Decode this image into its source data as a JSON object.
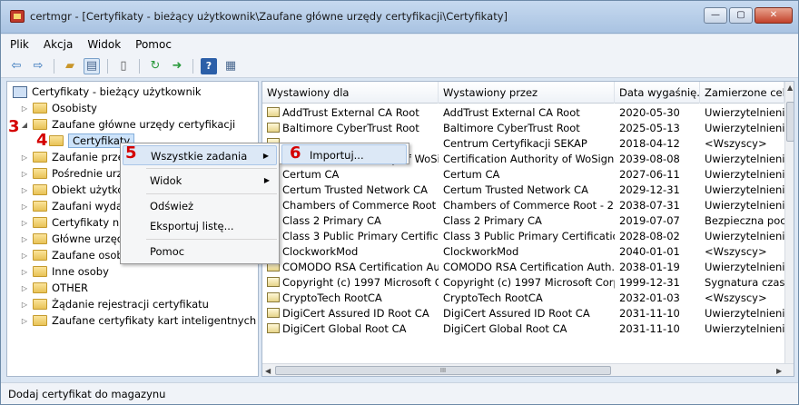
{
  "window": {
    "title": "certmgr - [Certyfikaty - bieżący użytkownik\\Zaufane główne urzędy certyfikacji\\Certyfikaty]",
    "minimize": "—",
    "maximize": "▢",
    "close": "✕"
  },
  "menu": [
    "Plik",
    "Akcja",
    "Widok",
    "Pomoc"
  ],
  "tree": {
    "root": "Certyfikaty - bieżący użytkownik",
    "items": [
      "Osobisty",
      "Zaufane główne urzędy certyfikacji",
      "Certyfikaty",
      "Zaufanie przed",
      "Pośrednie urze",
      "Obiekt użytkow",
      "Zaufani wydaw",
      "Certyfikaty nie",
      "Główne urzędy",
      "Zaufane osoby",
      "Inne osoby",
      "OTHER",
      "Żądanie rejestracji certyfikatu",
      "Zaufane certyfikaty kart inteligentnych"
    ]
  },
  "table": {
    "columns": [
      "Wystawiony dla",
      "Wystawiony przez",
      "Data wygaśnię...",
      "Zamierzone cele"
    ],
    "rows": [
      [
        "AddTrust External CA Root",
        "AddTrust External CA Root",
        "2020-05-30",
        "Uwierzytelnienie"
      ],
      [
        "Baltimore CyberTrust Root",
        "Baltimore CyberTrust Root",
        "2025-05-13",
        "Uwierzytelnienie"
      ],
      [
        "",
        "Centrum Certyfikacji SEKAP",
        "2018-04-12",
        "<Wszyscy>"
      ],
      [
        "Certification Authority of WoSign",
        "Certification Authority of WoSign",
        "2039-08-08",
        "Uwierzytelnienie"
      ],
      [
        "Certum CA",
        "Certum CA",
        "2027-06-11",
        "Uwierzytelnienie"
      ],
      [
        "Certum Trusted Network CA",
        "Certum Trusted Network CA",
        "2029-12-31",
        "Uwierzytelnienie"
      ],
      [
        "Chambers of Commerce Root -...",
        "Chambers of Commerce Root - 2...",
        "2038-07-31",
        "Uwierzytelnienie"
      ],
      [
        "Class 2 Primary CA",
        "Class 2 Primary CA",
        "2019-07-07",
        "Bezpieczna pocz"
      ],
      [
        "Class 3 Public Primary Certificat...",
        "Class 3 Public Primary Certificatio...",
        "2028-08-02",
        "Uwierzytelnienie"
      ],
      [
        "ClockworkMod",
        "ClockworkMod",
        "2040-01-01",
        "<Wszyscy>"
      ],
      [
        "COMODO RSA Certification Au...",
        "COMODO RSA Certification Auth...",
        "2038-01-19",
        "Uwierzytelnienie"
      ],
      [
        "Copyright (c) 1997 Microsoft C...",
        "Copyright (c) 1997 Microsoft Corp.",
        "1999-12-31",
        "Sygnatura czaso"
      ],
      [
        "CryptoTech RootCA",
        "CryptoTech RootCA",
        "2032-01-03",
        "<Wszyscy>"
      ],
      [
        "DigiCert Assured ID Root CA",
        "DigiCert Assured ID Root CA",
        "2031-11-10",
        "Uwierzytelnienie"
      ],
      [
        "DigiCert Global Root CA",
        "DigiCert Global Root CA",
        "2031-11-10",
        "Uwierzytelnienie"
      ]
    ],
    "hscroll_label": "III"
  },
  "context_menu": {
    "items": [
      "Wszystkie zadania",
      "Widok",
      "Odśwież",
      "Eksportuj listę...",
      "Pomoc"
    ]
  },
  "submenu": {
    "items": [
      "Importuj..."
    ]
  },
  "steps": [
    "3",
    "4",
    "5",
    "6"
  ],
  "status": "Dodaj certyfikat do magazynu"
}
